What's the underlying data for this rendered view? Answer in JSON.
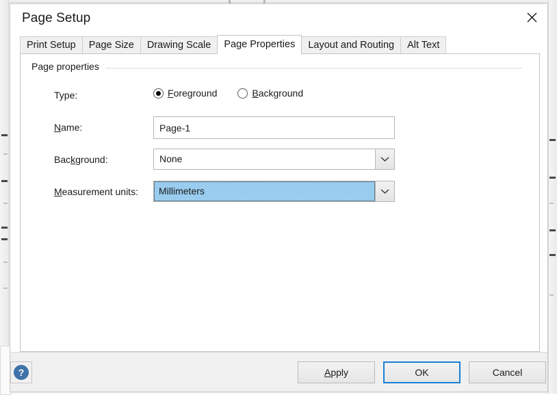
{
  "window": {
    "title": "Page Setup",
    "close_icon": "close-icon"
  },
  "tabs": [
    {
      "label": "Print Setup",
      "selected": false
    },
    {
      "label": "Page Size",
      "selected": false
    },
    {
      "label": "Drawing Scale",
      "selected": false
    },
    {
      "label": "Page Properties",
      "selected": true
    },
    {
      "label": "Layout and Routing",
      "selected": false
    },
    {
      "label": "Alt Text",
      "selected": false
    }
  ],
  "group": {
    "legend": "Page properties"
  },
  "form": {
    "type": {
      "label": "Type:",
      "options": [
        {
          "label_before": "",
          "accel": "F",
          "label_after": "oreground",
          "selected": true
        },
        {
          "label_before": "",
          "accel": "B",
          "label_after": "ackground",
          "selected": false
        }
      ]
    },
    "name": {
      "accel": "N",
      "label_after": "ame:",
      "value": "Page-1"
    },
    "background": {
      "label_before": "Bac",
      "accel": "k",
      "label_after": "ground:",
      "value": "None",
      "arrow_icon": "chevron-down-icon"
    },
    "measurement_units": {
      "accel": "M",
      "label_after": "easurement units:",
      "value": "Millimeters",
      "arrow_icon": "chevron-down-icon",
      "focused": true
    }
  },
  "footer": {
    "help_glyph": "?",
    "buttons": [
      {
        "label_before": "",
        "accel": "A",
        "label_after": "pply",
        "default": false
      },
      {
        "label_before": "OK",
        "accel": "",
        "label_after": "",
        "default": true
      },
      {
        "label_before": "Cancel",
        "accel": "",
        "label_after": "",
        "default": false
      }
    ]
  },
  "colors": {
    "accent": "#1a7fd4",
    "selection": "#99ccee",
    "help_blue": "#3f72a8"
  }
}
